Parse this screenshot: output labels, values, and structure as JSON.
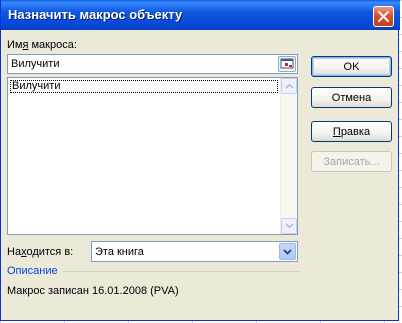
{
  "dialog": {
    "title": "Назначить макрос объекту"
  },
  "macro_name": {
    "label_pre": "Им",
    "label_key": "я",
    "label_post": " макроса:",
    "value": "Вилучити"
  },
  "macro_list": {
    "items": [
      "Вилучити"
    ]
  },
  "buttons": {
    "ok": "OK",
    "cancel": "Отмена",
    "edit_key": "П",
    "edit_rest": "равка",
    "record": "Записать..."
  },
  "location": {
    "label_pre": "На",
    "label_key": "х",
    "label_post": "одится в:",
    "selected": "Эта книга"
  },
  "description": {
    "header": "Описание",
    "text": "Макрос записан 16.01.2008 (PVA)"
  },
  "colors": {
    "titlebar": "#0547d6",
    "dialog_bg": "#ece9d8",
    "description_header": "#0046d5"
  }
}
